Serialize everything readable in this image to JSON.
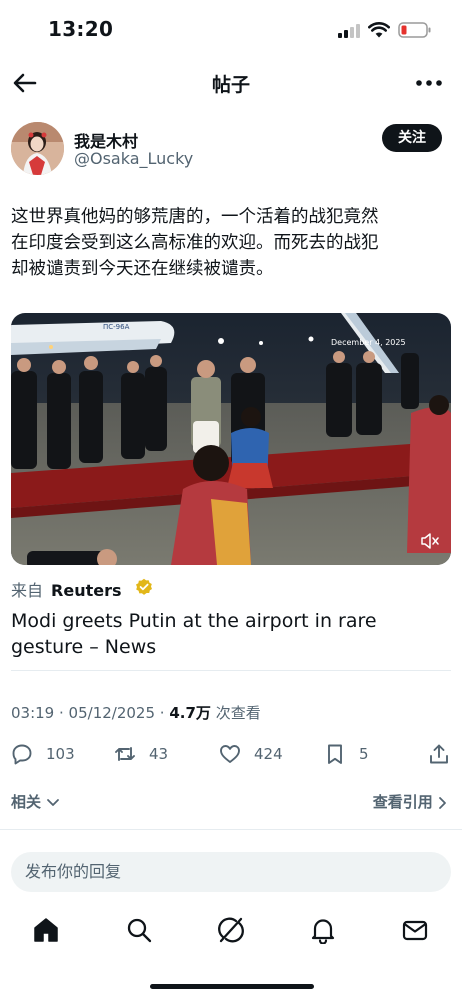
{
  "status": {
    "time": "13:20",
    "battery_color": "#e5322d"
  },
  "nav": {
    "title": "帖子",
    "back_icon": "arrow-left-icon",
    "more_icon": "more-horizontal-icon"
  },
  "author": {
    "name": "我是木村",
    "handle": "@Osaka_Lucky",
    "follow_label": "关注"
  },
  "tweet": {
    "lines": [
      "这世界真他妈的够荒唐的，一个活着的战犯竟然",
      "在印度会受到这么高标准的欢迎。而死去的战犯",
      "却被谴责到今天还在继续被谴责。"
    ]
  },
  "media": {
    "overlay_text": "December 4, 2025",
    "plane_label": "ПС-96А"
  },
  "card": {
    "source_prefix": "来自",
    "source_name": "Reuters",
    "headline": "Modi greets Putin at the airport in rare gesture – News"
  },
  "meta": {
    "time": "03:19",
    "date": "05/12/2025",
    "views": "4.7万",
    "views_label": "次查看"
  },
  "actions": {
    "replies": "103",
    "reposts": "43",
    "likes": "424",
    "bookmarks": "5"
  },
  "links": {
    "related": "相关",
    "quotes": "查看引用"
  },
  "reply": {
    "placeholder": "发布你的回复"
  },
  "colors": {
    "text": "#0f1419",
    "secondary": "#536471",
    "verified": "#e2b719",
    "carpet": "#8b1a1a"
  }
}
